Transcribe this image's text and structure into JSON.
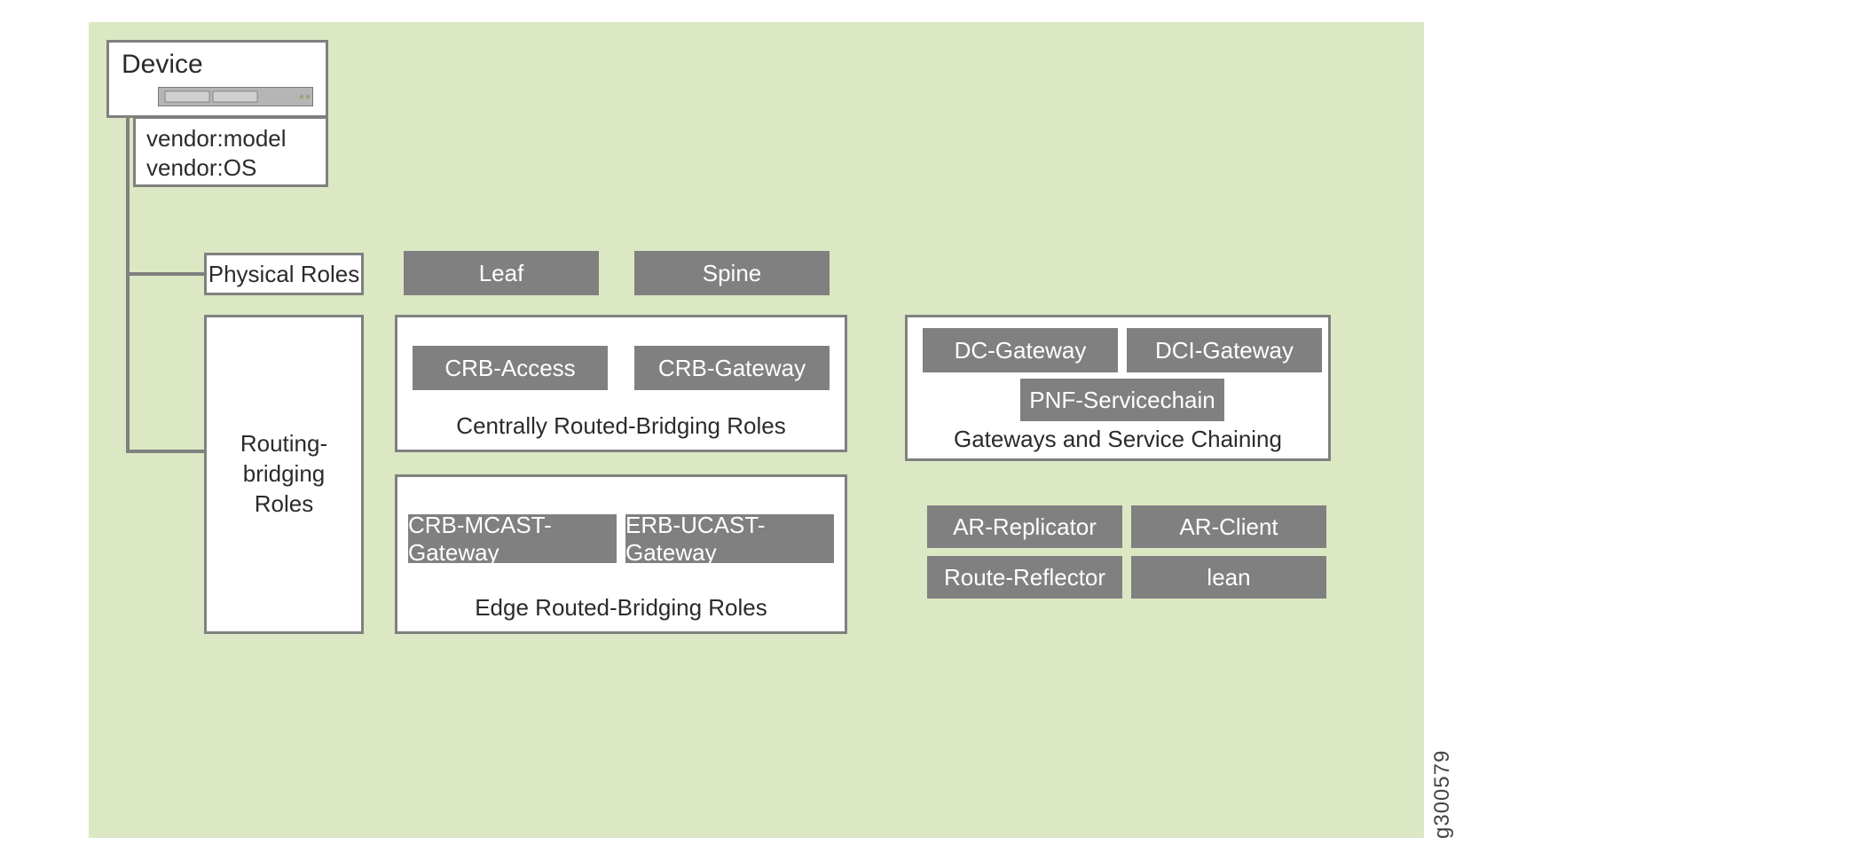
{
  "image_id": "g300579",
  "device": {
    "title": "Device",
    "vendor_model": "vendor:model",
    "vendor_os": "vendor:OS"
  },
  "physical_roles": {
    "label": "Physical Roles",
    "items": [
      "Leaf",
      "Spine"
    ]
  },
  "routing_bridging": {
    "label": "Routing-bridging Roles",
    "crb": {
      "caption": "Centrally Routed-Bridging Roles",
      "items": [
        "CRB-Access",
        "CRB-Gateway"
      ]
    },
    "erb": {
      "caption": "Edge Routed-Bridging Roles",
      "items": [
        "CRB-MCAST-Gateway",
        "ERB-UCAST-Gateway"
      ]
    },
    "gateways": {
      "caption": "Gateways and Service Chaining",
      "items": [
        "DC-Gateway",
        "DCI-Gateway",
        "PNF-Servicechain"
      ]
    },
    "misc": {
      "items": [
        "AR-Replicator",
        "AR-Client",
        "Route-Reflector",
        "lean"
      ]
    }
  }
}
